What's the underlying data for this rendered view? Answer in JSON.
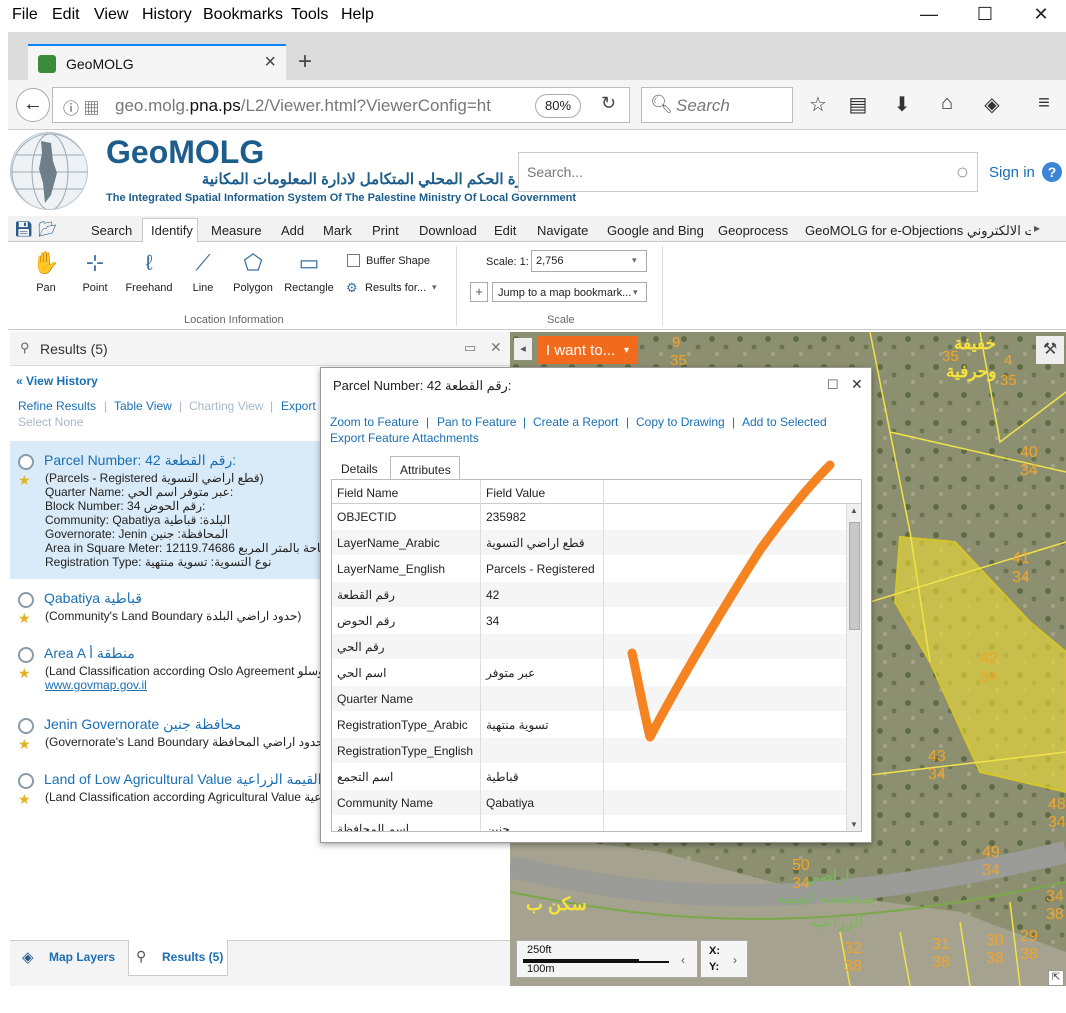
{
  "browser": {
    "menu": [
      "File",
      "Edit",
      "View",
      "History",
      "Bookmarks",
      "Tools",
      "Help"
    ],
    "tab_title": "GeoMOLG",
    "url_gray1": "geo.molg.",
    "url_dark": "pna.ps",
    "url_gray2": "/L2/Viewer.html?ViewerConfig=ht",
    "zoom": "80%",
    "search_placeholder": "Search"
  },
  "app": {
    "brand": "GeoMOLG",
    "brand_arabic": "نظام وزارة الحكم المحلي المتكامل لادارة المعلومات المكانية",
    "brand_english": "The Integrated Spatial Information System Of The Palestine Ministry Of Local Government",
    "search_placeholder": "Search...",
    "sign_in": "Sign in",
    "help": "?"
  },
  "ribbon": {
    "tabs": [
      "Search",
      "Identify",
      "Measure",
      "Add",
      "Mark",
      "Print",
      "Download",
      "Edit",
      "Navigate",
      "Google and Bing",
      "Geoprocess",
      "GeoMOLG for e-Objections الاعتراضات الالكتروني"
    ],
    "tools": [
      "Pan",
      "Point",
      "Freehand",
      "Line",
      "Polygon",
      "Rectangle"
    ],
    "buffer_shape": "Buffer Shape",
    "results_for": "Results for...",
    "group_location": "Location Information",
    "scale_label": "Scale: 1:",
    "scale_value": "2,756",
    "bookmark": "Jump to a map bookmark...",
    "group_scale": "Scale"
  },
  "results": {
    "header": "Results (5)",
    "view_history": "View History",
    "refine": "Refine Results",
    "table_view": "Table View",
    "charting": "Charting View",
    "export": "Export",
    "select_none": "Select None",
    "items": [
      {
        "title": "Parcel Number: 42  رقم القطعة:",
        "lines": [
          "(Parcels - Registered  قطع اراضي التسوية)",
          "Quarter Name: عبر متوفر  اسم الحي:",
          "Block Number: 34  رقم الحوض:",
          "Community: Qabatiya  البلدة: قباطية",
          "Governorate: Jenin  المحافظة: جنين",
          "Area in Square Meter: 12119.74686  المساحة بالمتر المربع:",
          "Registration Type:  نوع التسوية: تسوية منتهية"
        ]
      },
      {
        "title": "Qabatiya  قباطية",
        "lines": [
          "(Community's Land Boundary  حدود اراضي البلدة)"
        ]
      },
      {
        "title": "Area A  منطقة أ",
        "lines": [
          "(Land Classification according Oslo Agreement  اوسلو",
          "www.govmap.gov.il"
        ]
      },
      {
        "title": "Jenin Governorate  محافظة جنين",
        "lines": [
          "(Governorate's Land Boundary  حدود اراضي المحافظة)"
        ]
      },
      {
        "title": "Land of Low Agricultural Value  اراضي منخفضة القيمة الزراعية",
        "lines": [
          "(Land Classification according Agricultural Value  الزراعية"
        ]
      }
    ]
  },
  "bottom_tabs": {
    "map_layers": "Map Layers",
    "results": "Results (5)"
  },
  "map": {
    "i_want_to": "I want to...",
    "labels": [
      "9",
      "35",
      "خفيفة",
      "وحرفية",
      "35",
      "4",
      "35",
      "40",
      "34",
      "41",
      "34",
      "42",
      "34",
      "43",
      "34",
      "48",
      "34",
      "49",
      "34",
      "50",
      "34",
      "اراضي",
      "منخفضة القيمة",
      "الزراعية",
      "32",
      "38",
      "31",
      "38",
      "30",
      "38",
      "29",
      "38",
      "34",
      "38",
      "سكن ب"
    ],
    "scale_ft": "250ft",
    "scale_m": "100m",
    "x_label": "X:",
    "y_label": "Y:"
  },
  "popup": {
    "title": "Parcel Number: 42  رقم القطعة:",
    "actions": [
      "Zoom to Feature",
      "Pan to Feature",
      "Create a Report",
      "Copy to Drawing",
      "Add to Selected"
    ],
    "export_attachments": "Export Feature Attachments",
    "tab_details": "Details",
    "tab_attributes": "Attributes",
    "col_name": "Field Name",
    "col_value": "Field Value",
    "rows": [
      [
        "OBJECTID",
        "235982"
      ],
      [
        "LayerName_Arabic",
        "قطع اراضي التسوية"
      ],
      [
        "LayerName_English",
        "Parcels - Registered"
      ],
      [
        "رقم القطعة",
        "42"
      ],
      [
        "رقم الحوض",
        "34"
      ],
      [
        "رقم الحي",
        ""
      ],
      [
        "اسم الحي",
        "عبر متوفر"
      ],
      [
        "Quarter Name",
        ""
      ],
      [
        "RegistrationType_Arabic",
        "تسوية منتهية"
      ],
      [
        "RegistrationType_English",
        ""
      ],
      [
        "اسم التجمع",
        "قباطية"
      ],
      [
        "Community Name",
        "Qabatiya"
      ],
      [
        "اسم المحافظة",
        "جنين"
      ]
    ]
  },
  "colors": {
    "brand": "#1c5d8c",
    "link": "#1a6fb4",
    "orange": "#f26b1d",
    "check": "#f5780f"
  }
}
